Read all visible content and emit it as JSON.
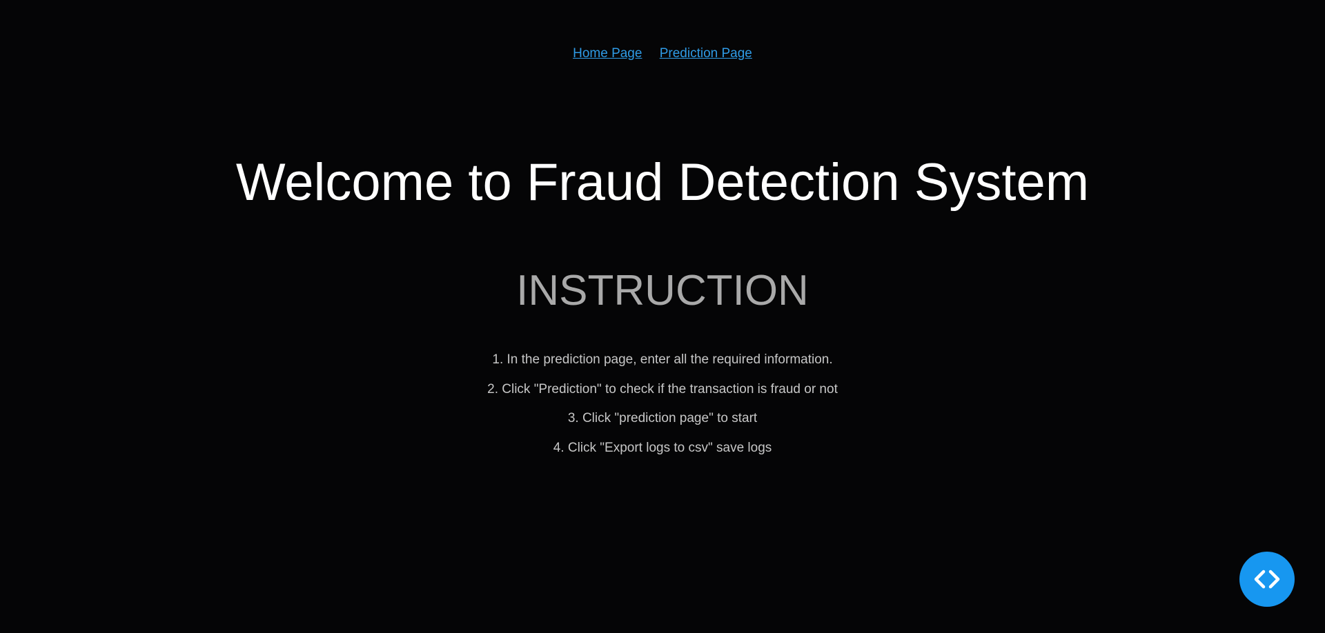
{
  "nav": {
    "home_label": "Home Page",
    "prediction_label": "Prediction Page"
  },
  "main": {
    "title": "Welcome to Fraud Detection System",
    "subtitle": "INSTRUCTION",
    "steps": [
      "1. In the prediction page, enter all the required information.",
      "2. Click \"Prediction\" to check if the transaction is fraud or not",
      "3. Click \"prediction page\" to start",
      "4. Click \"Export logs to csv\" save logs"
    ]
  },
  "fab": {
    "icon": "code-brackets-icon",
    "color": "#1797f0"
  },
  "colors": {
    "background": "#050506",
    "link": "#2f9be6",
    "title": "#ffffff",
    "subtitle": "#a9a9a9",
    "body_text": "#c7c7c7"
  }
}
